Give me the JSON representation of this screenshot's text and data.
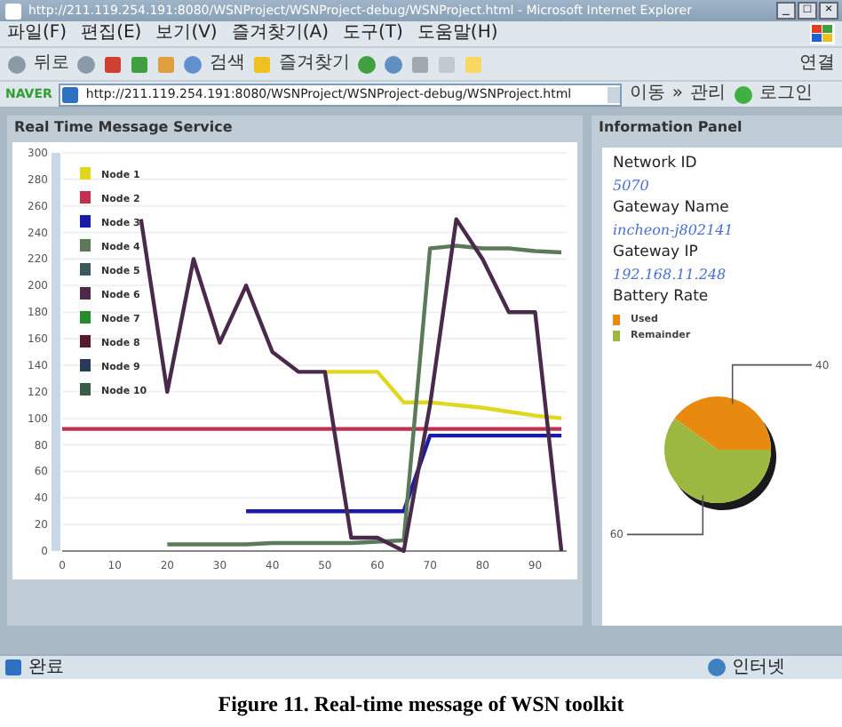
{
  "window": {
    "title": "http://211.119.254.191:8080/WSNProject/WSNProject-debug/WSNProject.html - Microsoft Internet Explorer",
    "controls": [
      "_",
      "□",
      "×"
    ]
  },
  "menu": [
    "파일(F)",
    "편집(E)",
    "보기(V)",
    "즐겨찾기(A)",
    "도구(T)",
    "도움말(H)"
  ],
  "toolbar": {
    "back": "뒤로",
    "search": "검색",
    "favorites": "즐겨찾기",
    "links": "연결"
  },
  "address_bar": {
    "brand": "NAVER",
    "url": "http://211.119.254.191:8080/WSNProject/WSNProject-debug/WSNProject.html",
    "go": "이동",
    "more": "»",
    "manage": "관리",
    "login": "로그인"
  },
  "message_panel": {
    "title": "Real Time Message Service",
    "chart_data": {
      "type": "line",
      "grid": true,
      "legend": "upper left",
      "x": [
        0,
        5,
        10,
        15,
        20,
        25,
        30,
        35,
        40,
        45,
        50,
        55,
        60,
        65,
        70,
        75,
        80,
        85,
        90,
        95
      ],
      "xlim": [
        0,
        96
      ],
      "ylim": [
        0,
        300
      ],
      "xticks": [
        0,
        10,
        20,
        30,
        40,
        50,
        60,
        70,
        80,
        90
      ],
      "yticks": [
        0,
        20,
        40,
        60,
        80,
        100,
        120,
        140,
        160,
        180,
        200,
        220,
        240,
        260,
        280,
        300
      ],
      "series": [
        {
          "name": "Node 1",
          "color": "#e0d820",
          "values": [
            null,
            null,
            null,
            null,
            null,
            null,
            null,
            null,
            null,
            null,
            135,
            135,
            135,
            112,
            112,
            110,
            108,
            105,
            102,
            100
          ]
        },
        {
          "name": "Node 2",
          "color": "#c03050",
          "values": [
            92,
            92,
            92,
            92,
            92,
            92,
            92,
            92,
            92,
            92,
            92,
            92,
            92,
            92,
            92,
            92,
            92,
            92,
            92,
            92
          ]
        },
        {
          "name": "Node 3",
          "color": "#1a1aa8",
          "values": [
            null,
            null,
            null,
            null,
            null,
            null,
            null,
            30,
            30,
            30,
            30,
            30,
            30,
            30,
            87,
            87,
            87,
            87,
            87,
            87
          ]
        },
        {
          "name": "Node 4",
          "color": "#5a7a5a",
          "values": [
            null,
            null,
            null,
            null,
            5,
            5,
            5,
            5,
            6,
            6,
            6,
            6,
            7,
            8,
            228,
            230,
            228,
            228,
            226,
            225
          ]
        },
        {
          "name": "Node 5",
          "color": "#3a5a5a",
          "values": [
            null,
            null,
            null,
            null,
            null,
            null,
            null,
            null,
            null,
            null,
            null,
            null,
            null,
            null,
            null,
            null,
            null,
            null,
            null,
            null
          ]
        },
        {
          "name": "Node 6",
          "color": "#4a2a4a",
          "values": [
            null,
            null,
            null,
            250,
            120,
            220,
            157,
            200,
            150,
            135,
            135,
            10,
            10,
            0,
            110,
            250,
            220,
            180,
            180,
            0
          ]
        },
        {
          "name": "Node 7",
          "color": "#2a8a2a",
          "values": [
            null,
            null,
            null,
            null,
            null,
            null,
            null,
            null,
            null,
            null,
            null,
            null,
            null,
            null,
            null,
            null,
            null,
            null,
            null,
            null
          ]
        },
        {
          "name": "Node 8",
          "color": "#5a1a2a",
          "values": [
            null,
            null,
            null,
            null,
            null,
            null,
            null,
            null,
            null,
            null,
            null,
            null,
            null,
            null,
            null,
            null,
            null,
            null,
            null,
            null
          ]
        },
        {
          "name": "Node 9",
          "color": "#2a3a5a",
          "values": [
            null,
            null,
            null,
            null,
            null,
            null,
            null,
            null,
            null,
            null,
            null,
            null,
            null,
            null,
            null,
            null,
            null,
            null,
            null,
            null
          ]
        },
        {
          "name": "Node 10",
          "color": "#3a5a4a",
          "values": [
            null,
            null,
            null,
            null,
            null,
            null,
            null,
            null,
            null,
            null,
            null,
            null,
            null,
            null,
            null,
            null,
            null,
            null,
            null,
            null
          ]
        }
      ]
    }
  },
  "info_panel": {
    "title": "Information Panel",
    "fields": [
      {
        "label": "Network ID",
        "value": "5070"
      },
      {
        "label": "Gateway Name",
        "value": "incheon-j802141"
      },
      {
        "label": "Gateway IP",
        "value": "192.168.11.248"
      }
    ],
    "battery": {
      "label": "Battery Rate",
      "chart_data": {
        "type": "pie",
        "categories": [
          "Used",
          "Remainder"
        ],
        "legend": "upper left",
        "colors": [
          "#e88a10",
          "#9cb840"
        ],
        "series": [
          {
            "values": [
              40,
              60
            ]
          }
        ],
        "data_labels": true
      }
    }
  },
  "status_bar": {
    "text": "완료",
    "zone": "인터넷"
  },
  "caption": "Figure 11. Real-time message of WSN toolkit"
}
